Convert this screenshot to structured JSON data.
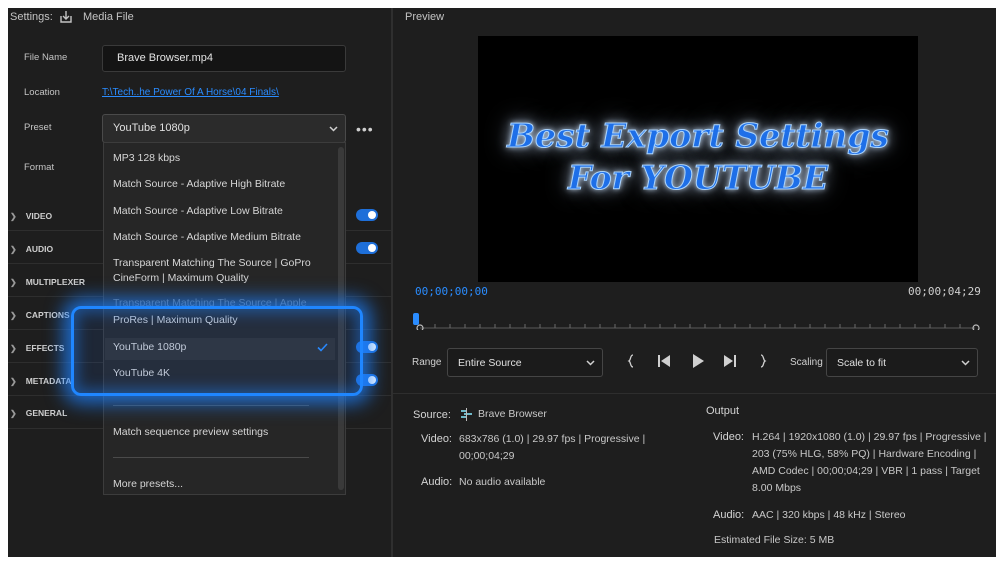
{
  "header": {
    "settings": "Settings:",
    "media_file": "Media File",
    "preview": "Preview"
  },
  "fields": {
    "file_name_label": "File Name",
    "file_name_value": "Brave Browser.mp4",
    "location_label": "Location",
    "location_value": "T:\\Tech..he Power Of A Horse\\04 Finals\\",
    "preset_label": "Preset",
    "preset_value": "YouTube 1080p",
    "format_label": "Format"
  },
  "sections": [
    "VIDEO",
    "AUDIO",
    "MULTIPLEXER",
    "CAPTIONS",
    "EFFECTS",
    "METADATA",
    "GENERAL"
  ],
  "toggles": {
    "video": true,
    "audio": true,
    "effects": true,
    "metadata": true
  },
  "dropdown": {
    "items": [
      "MP3 128 kbps",
      "Match Source - Adaptive High Bitrate",
      "Match Source - Adaptive Low Bitrate",
      "Match Source - Adaptive Medium Bitrate",
      "Transparent Matching The Source | GoPro CineForm | Maximum Quality",
      "Transparent Matching The Source | Apple",
      "ProRes | Maximum Quality",
      "YouTube 1080p",
      "YouTube 4K"
    ],
    "selected": "YouTube 1080p",
    "match_sequence": "Match sequence preview settings",
    "more_presets": "More presets..."
  },
  "preview": {
    "overlay_line1": "Best Export Settings",
    "overlay_line2": "For YOUTUBE",
    "timecode_start": "00;00;00;00",
    "timecode_end": "00;00;04;29"
  },
  "controls": {
    "range_label": "Range",
    "range_value": "Entire Source",
    "scaling_label": "Scaling",
    "scaling_value": "Scale to fit"
  },
  "source": {
    "label": "Source:",
    "name": "Brave Browser",
    "video_label": "Video:",
    "video_line1": "683x786 (1.0)  |  29.97 fps  |  Progressive  |",
    "video_line2": "00;00;04;29",
    "audio_label": "Audio:",
    "audio_value": "No audio available"
  },
  "output": {
    "label": "Output",
    "video_label": "Video:",
    "video_line1": "H.264  |  1920x1080 (1.0)  |  29.97 fps  |  Progressive  |",
    "video_line2": "203 (75% HLG, 58% PQ)  |  Hardware Encoding  |",
    "video_line3": "AMD Codec  |  00;00;04;29   |  VBR  |  1 pass  |  Target",
    "video_line4": "8.00 Mbps",
    "audio_label": "Audio:",
    "audio_value": "AAC  |  320 kbps  |  48 kHz  |  Stereo",
    "file_size": "Estimated File Size:  5 MB"
  },
  "colors": {
    "accent": "#1e6fd9",
    "link": "#2a8cff",
    "highlight": "#1f86ff"
  }
}
